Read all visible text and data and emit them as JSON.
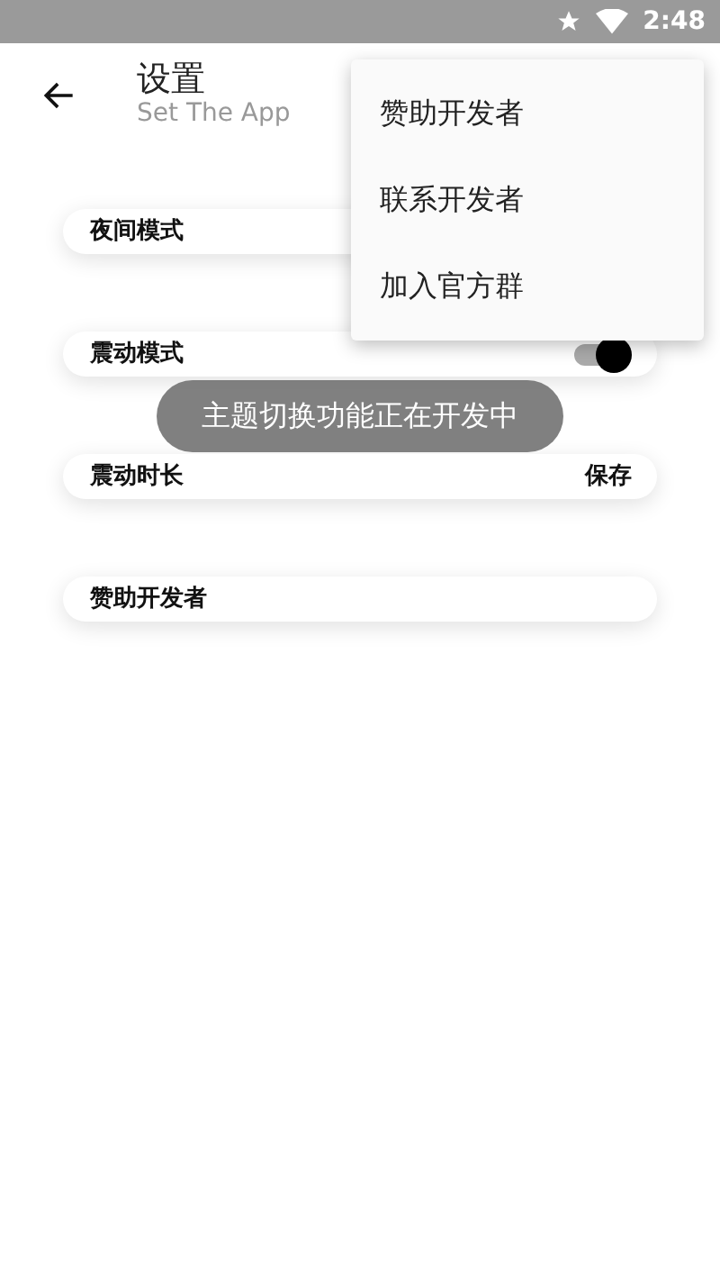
{
  "status_bar": {
    "time": "2:48"
  },
  "header": {
    "title": "设置",
    "subtitle": "Set The App"
  },
  "settings": [
    {
      "kind": "plain",
      "label": "夜间模式"
    },
    {
      "kind": "toggle",
      "label": "震动模式",
      "on": true
    },
    {
      "kind": "action",
      "label": "震动时长",
      "action": "保存"
    },
    {
      "kind": "plain",
      "label": "赞助开发者"
    }
  ],
  "menu": {
    "items": [
      "赞助开发者",
      "联系开发者",
      "加入官方群"
    ]
  },
  "toast": {
    "text": "主题切换功能正在开发中"
  }
}
